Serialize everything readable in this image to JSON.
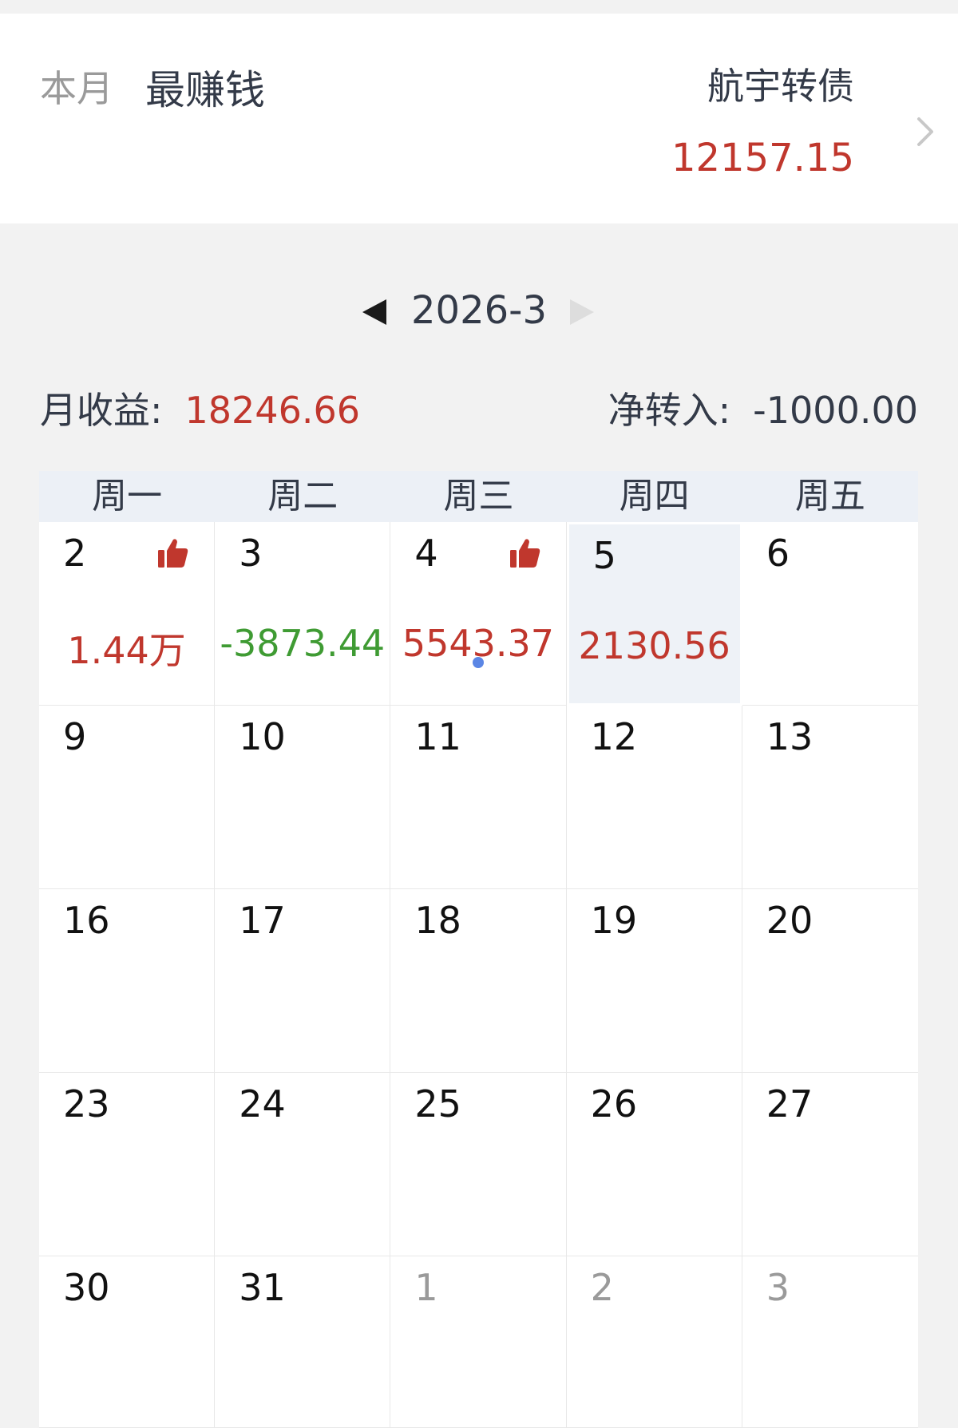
{
  "summary": {
    "period": "本月",
    "title": "最赚钱",
    "top_name": "航宇转债",
    "top_value": "12157.15"
  },
  "nav": {
    "month": "2026-3"
  },
  "stats": {
    "monthly_income_label": "月收益:",
    "monthly_income_value": "18246.66",
    "net_transfer_label": "净转入:",
    "net_transfer_value": "-1000.00"
  },
  "calendar": {
    "weekdays": [
      "周一",
      "周二",
      "周三",
      "周四",
      "周五"
    ],
    "weeks": [
      [
        {
          "day": "2",
          "value": "1.44万",
          "trend": "up",
          "thumb": true
        },
        {
          "day": "3",
          "value": "-3873.44",
          "trend": "down"
        },
        {
          "day": "4",
          "value": "5543.37",
          "trend": "up",
          "thumb": true,
          "dot": true
        },
        {
          "day": "5",
          "value": "2130.56",
          "trend": "up",
          "today": true
        },
        {
          "day": "6"
        }
      ],
      [
        {
          "day": "9"
        },
        {
          "day": "10"
        },
        {
          "day": "11"
        },
        {
          "day": "12"
        },
        {
          "day": "13"
        }
      ],
      [
        {
          "day": "16"
        },
        {
          "day": "17"
        },
        {
          "day": "18"
        },
        {
          "day": "19"
        },
        {
          "day": "20"
        }
      ],
      [
        {
          "day": "23"
        },
        {
          "day": "24"
        },
        {
          "day": "25"
        },
        {
          "day": "26"
        },
        {
          "day": "27"
        }
      ],
      [
        {
          "day": "30"
        },
        {
          "day": "31"
        },
        {
          "day": "1",
          "other": true
        },
        {
          "day": "2",
          "other": true
        },
        {
          "day": "3",
          "other": true
        }
      ]
    ]
  },
  "colors": {
    "gain": "#c0372d",
    "loss": "#3f9b33",
    "dot": "#5b86e5",
    "text": "#333a48"
  },
  "icons": {
    "prev": "triangle-left-icon",
    "next": "triangle-right-icon",
    "detail": "chevron-right-icon",
    "thumb": "thumbs-up-icon"
  }
}
